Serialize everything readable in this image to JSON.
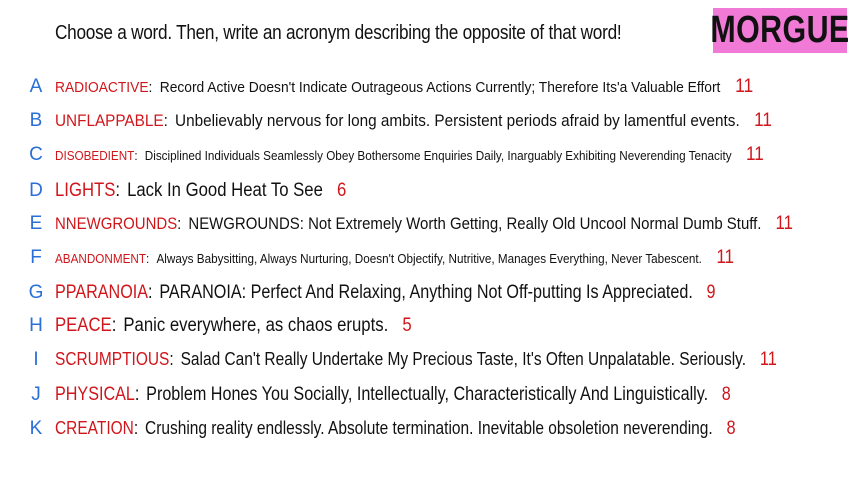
{
  "prompt": "Choose a word. Then, write an acronym describing the opposite of that word!",
  "badge": "MORGUE",
  "colors": {
    "letter": "#2a6fd6",
    "word": "#d0161b",
    "badge_bg": "#f07ad6"
  },
  "entries": [
    {
      "letter": "A",
      "word": "RADIOACTIVE",
      "acronym": "Record Active Doesn't Indicate Outrageous Actions Currently; Therefore Its'a Valuable Effort",
      "count": "11"
    },
    {
      "letter": "B",
      "word": "UNFLAPPABLE",
      "acronym": "Unbelievably nervous for long ambits. Persistent periods afraid by lamentful events.",
      "count": "11"
    },
    {
      "letter": "C",
      "word": "DISOBEDIENT",
      "acronym": "Disciplined Individuals Seamlessly Obey Bothersome Enquiries Daily, Inarguably Exhibiting Neverending Tenacity",
      "count": "11"
    },
    {
      "letter": "D",
      "word": "LIGHTS",
      "acronym": "Lack In Good Heat To See",
      "count": "6"
    },
    {
      "letter": "E",
      "word": "NNEWGROUNDS",
      "acronym": "NEWGROUNDS: Not Extremely Worth Getting, Really Old Uncool Normal Dumb Stuff.",
      "count": "11"
    },
    {
      "letter": "F",
      "word": "ABANDONMENT",
      "acronym": "Always Babysitting, Always Nurturing, Doesn't Objectify, Nutritive, Manages Everything, Never Tabescent.",
      "count": "11"
    },
    {
      "letter": "G",
      "word": "PPARANOIA",
      "acronym": "PARANOIA: Perfect And Relaxing, Anything Not Off-putting Is Appreciated.",
      "count": "9"
    },
    {
      "letter": "H",
      "word": "PEACE",
      "acronym": "Panic everywhere, as chaos erupts.",
      "count": "5"
    },
    {
      "letter": "I",
      "word": "SCRUMPTIOUS",
      "acronym": "Salad Can't Really Undertake My Precious Taste, It's Often Unpalatable. Seriously.",
      "count": "11"
    },
    {
      "letter": "J",
      "word": "PHYSICAL",
      "acronym": "Problem Hones You Socially, Intellectually, Characteristically And Linguistically.",
      "count": "8"
    },
    {
      "letter": "K",
      "word": "CREATION",
      "acronym": "Crushing reality endlessly. Absolute termination. Inevitable obsoletion neverending.",
      "count": "8"
    }
  ]
}
